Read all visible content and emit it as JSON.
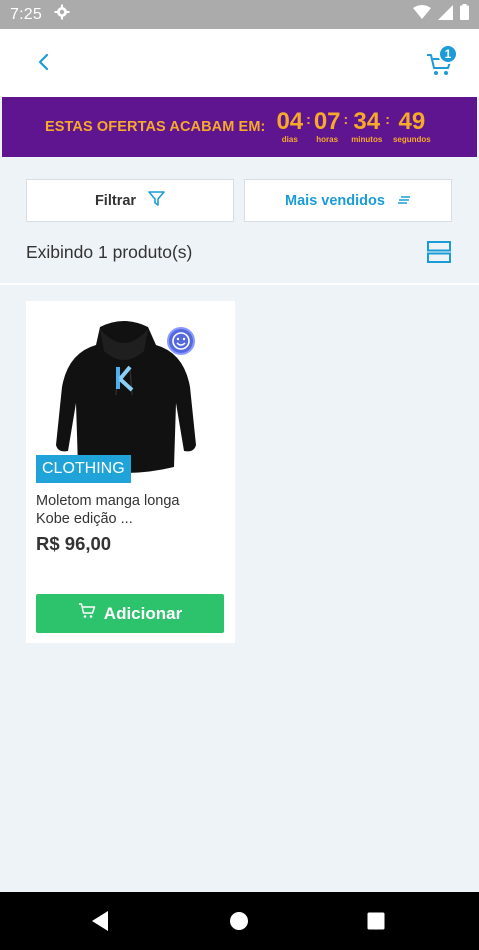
{
  "status_bar": {
    "time": "7:25"
  },
  "header": {
    "cart_count": "1"
  },
  "offer": {
    "text": "ESTAS OFERTAS ACABAM EM:",
    "timer": [
      {
        "value": "04",
        "label": "dias"
      },
      {
        "value": "07",
        "label": "horas"
      },
      {
        "value": "34",
        "label": "minutos"
      },
      {
        "value": "49",
        "label": "segundos"
      }
    ]
  },
  "filters": {
    "filter_label": "Filtrar",
    "sort_label": "Mais vendidos"
  },
  "results": {
    "count_text": "Exibindo 1 produto(s)"
  },
  "products": [
    {
      "category": "CLOTHING",
      "name_line1": "Moletom manga longa",
      "name_line2": "Kobe edição ...",
      "price": "R$ 96,00",
      "add_label": "Adicionar"
    }
  ],
  "colors": {
    "accent": "#1b9cd6",
    "banner": "#5f1590",
    "banner_text": "#f7a92a",
    "add_button": "#2dc26c",
    "category_tag": "#20a3d8"
  },
  "icons": [
    "gear-icon",
    "wifi-icon",
    "signal-icon",
    "battery-icon",
    "back-arrow-icon",
    "cart-icon",
    "filter-icon",
    "sort-icon",
    "layout-toggle-icon",
    "smiley-icon",
    "nav-back-icon",
    "nav-home-icon",
    "nav-recents-icon"
  ]
}
